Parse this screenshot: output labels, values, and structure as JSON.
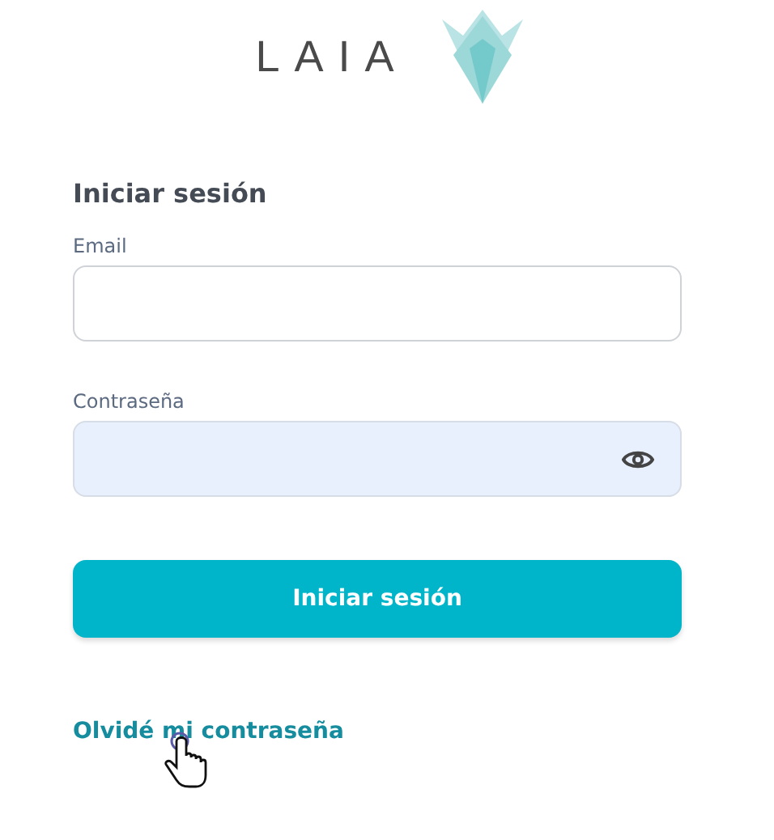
{
  "logo": {
    "text": "LAIA"
  },
  "form": {
    "title": "Iniciar sesión",
    "fields": [
      {
        "label": "Email",
        "kind": "text"
      },
      {
        "label": "Contraseña",
        "kind": "password"
      }
    ],
    "submit": "Iniciar sesión",
    "forgot_link": "Olvidé mi contraseña"
  }
}
